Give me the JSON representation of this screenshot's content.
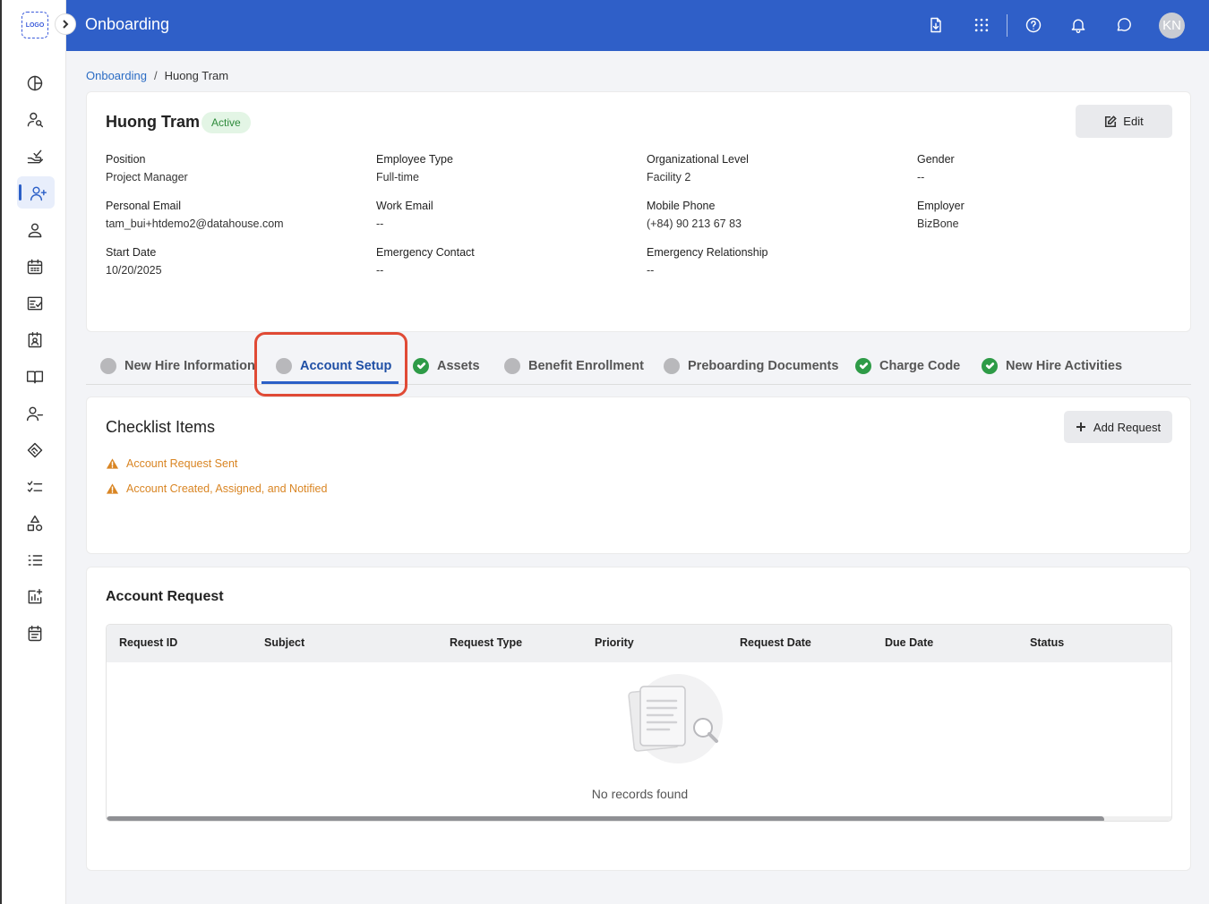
{
  "header": {
    "logo_text": "LOGO",
    "title": "Onboarding",
    "avatar_initials": "KN",
    "brand_color": "#2f5fc8"
  },
  "breadcrumb": {
    "parent": "Onboarding",
    "separator": "/",
    "current": "Huong Tram"
  },
  "employee": {
    "name": "Huong Tram",
    "status": "Active",
    "edit_label": "Edit",
    "fields": {
      "position": {
        "label": "Position",
        "value": "Project Manager"
      },
      "employee_type": {
        "label": "Employee Type",
        "value": "Full-time"
      },
      "org_level": {
        "label": "Organizational Level",
        "value": "Facility 2"
      },
      "gender": {
        "label": "Gender",
        "value": "--"
      },
      "personal_email": {
        "label": "Personal Email",
        "value": "tam_bui+htdemo2@datahouse.com"
      },
      "work_email": {
        "label": "Work Email",
        "value": "--"
      },
      "mobile_phone": {
        "label": "Mobile Phone",
        "value": "(+84) 90 213 67 83"
      },
      "employer": {
        "label": "Employer",
        "value": "BizBone"
      },
      "start_date": {
        "label": "Start Date",
        "value": "10/20/2025"
      },
      "emergency_contact": {
        "label": "Emergency Contact",
        "value": "--"
      },
      "emergency_relationship": {
        "label": "Emergency Relationship",
        "value": "--"
      }
    }
  },
  "tabs": [
    {
      "label": "New Hire Information",
      "state": "pending"
    },
    {
      "label": "Account Setup",
      "state": "pending",
      "active": true
    },
    {
      "label": "Assets",
      "state": "done"
    },
    {
      "label": "Benefit Enrollment",
      "state": "pending"
    },
    {
      "label": "Preboarding Documents",
      "state": "pending"
    },
    {
      "label": "Charge Code",
      "state": "done"
    },
    {
      "label": "New Hire Activities",
      "state": "done"
    }
  ],
  "checklist": {
    "title": "Checklist Items",
    "add_button_label": "Add Request",
    "items": [
      {
        "label": "Account Request Sent",
        "status": "warning"
      },
      {
        "label": "Account Created, Assigned, and Notified",
        "status": "warning"
      }
    ],
    "warning_color": "#d98523"
  },
  "account_request": {
    "title": "Account Request",
    "columns": [
      "Request ID",
      "Subject",
      "Request Type",
      "Priority",
      "Request Date",
      "Due Date",
      "Status"
    ],
    "rows": [],
    "empty_text": "No records found"
  },
  "sidebar": {
    "items": [
      "dashboard-icon",
      "user-search-icon",
      "hand-check-icon",
      "user-plus-icon",
      "user-icon",
      "calendar-icon",
      "checklist-form-icon",
      "id-badge-icon",
      "book-icon",
      "user-minus-icon",
      "handshake-icon",
      "list-check-icon",
      "shapes-icon",
      "list-ordered-icon",
      "chart-add-icon",
      "calendar-notes-icon"
    ],
    "active_index": 3
  }
}
